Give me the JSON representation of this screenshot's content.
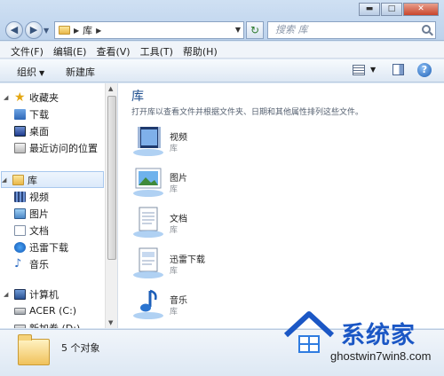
{
  "window": {
    "minimize": "▬",
    "maximize": "□",
    "close": "✕"
  },
  "address_bar": {
    "crumb": "库"
  },
  "search": {
    "placeholder": "搜索 库"
  },
  "menu": [
    "文件(F)",
    "编辑(E)",
    "查看(V)",
    "工具(T)",
    "帮助(H)"
  ],
  "toolbar": {
    "organize": "组织",
    "new_library": "新建库",
    "help": "?"
  },
  "nav": {
    "favorites": {
      "label": "收藏夹",
      "items": [
        "下载",
        "桌面",
        "最近访问的位置"
      ]
    },
    "libraries": {
      "label": "库",
      "items": [
        "视频",
        "图片",
        "文档",
        "迅雷下载",
        "音乐"
      ]
    },
    "computer": {
      "label": "计算机",
      "items": [
        "ACER (C:)",
        "新加卷 (D:)"
      ]
    }
  },
  "content": {
    "title": "库",
    "description": "打开库以查看文件并根据文件夹、日期和其他属性排列这些文件。",
    "libraries": [
      {
        "name": "视频",
        "type": "库",
        "icon": "video-library-icon"
      },
      {
        "name": "图片",
        "type": "库",
        "icon": "picture-library-icon"
      },
      {
        "name": "文档",
        "type": "库",
        "icon": "document-library-icon"
      },
      {
        "name": "迅雷下载",
        "type": "库",
        "icon": "thunder-library-icon"
      },
      {
        "name": "音乐",
        "type": "库",
        "icon": "music-library-icon"
      }
    ]
  },
  "status": {
    "count": "5 个对象"
  },
  "watermark": {
    "brand": "系统家",
    "url": "ghostwin7win8.com"
  }
}
